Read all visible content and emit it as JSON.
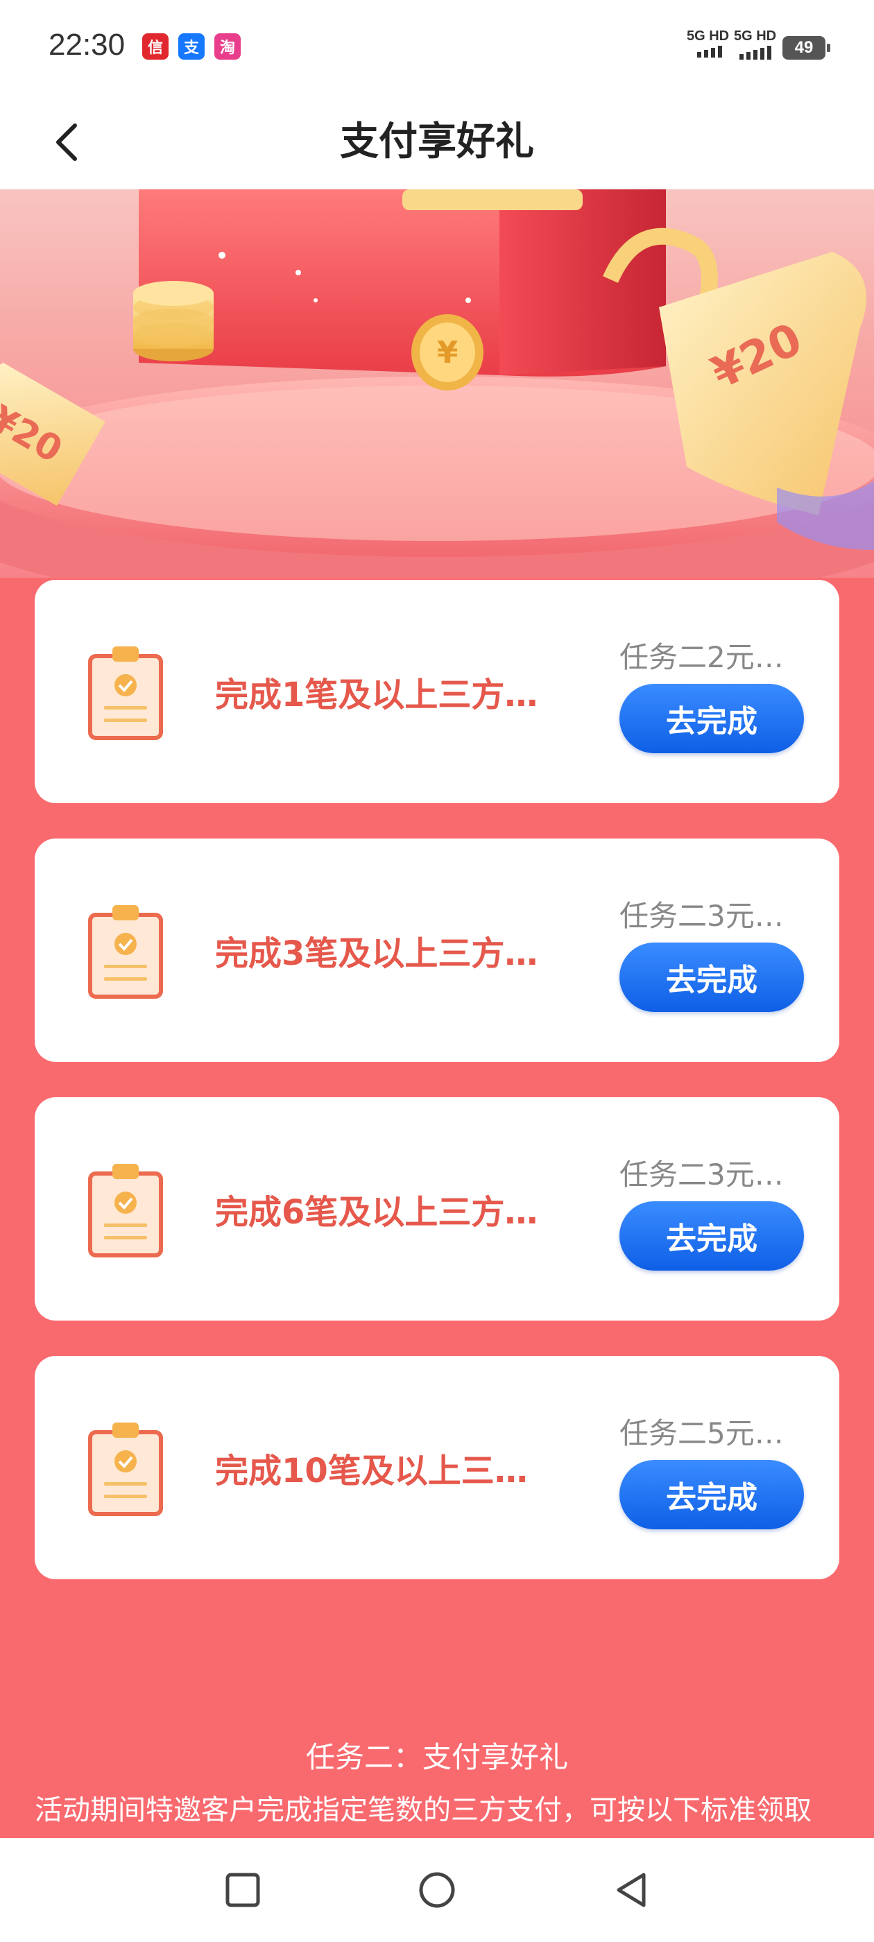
{
  "status_bar": {
    "time": "22:30",
    "signal1": "5G HD",
    "signal2": "5G HD",
    "battery": "49",
    "app_icons": [
      {
        "name": "app-notification-icon-1",
        "color": "#e0282e",
        "glyph": "信"
      },
      {
        "name": "alipay-icon",
        "color": "#1677ff",
        "glyph": "支"
      },
      {
        "name": "taobao-icon",
        "color": "#e83e8c",
        "glyph": "淘"
      }
    ]
  },
  "header": {
    "title": "支付享好礼"
  },
  "tasks": [
    {
      "title": "完成1笔及以上三方…",
      "reward": "任务二2元…",
      "button": "去完成"
    },
    {
      "title": "完成3笔及以上三方…",
      "reward": "任务二3元…",
      "button": "去完成"
    },
    {
      "title": "完成6笔及以上三方…",
      "reward": "任务二3元…",
      "button": "去完成"
    },
    {
      "title": "完成10笔及以上三…",
      "reward": "任务二5元…",
      "button": "去完成"
    }
  ],
  "rules": {
    "title": "任务二：支付享好礼",
    "text": "活动期间特邀客户完成指定笔数的三方支付，可按以下标准领取"
  },
  "banner": {
    "coupon_left": "¥20",
    "coupon_right": "¥20"
  },
  "colors": {
    "page_bg": "#f96a6f",
    "task_title": "#e5584b",
    "button_blue": "#1a6ff2"
  }
}
